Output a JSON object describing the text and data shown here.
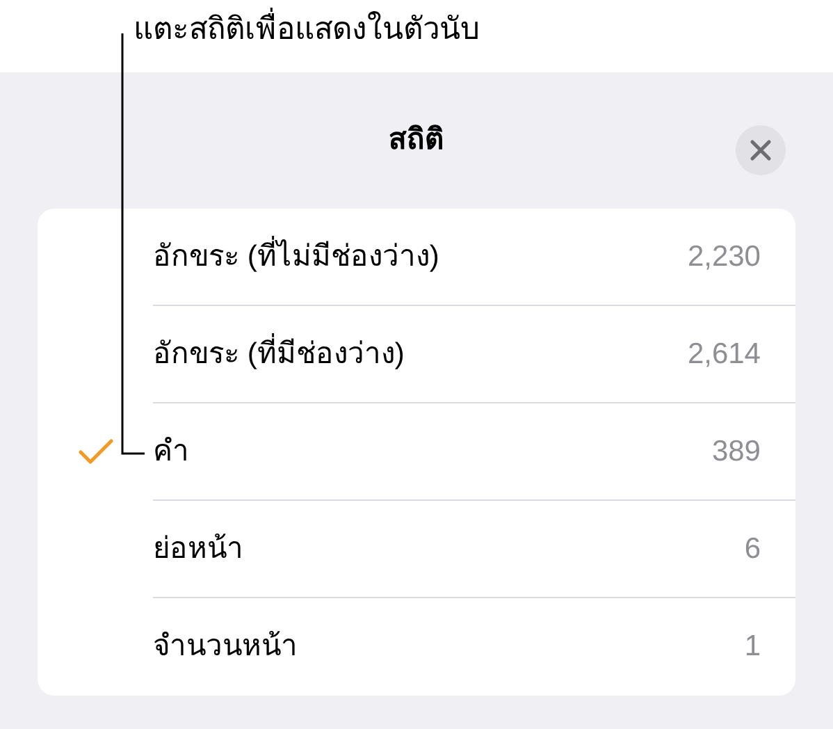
{
  "callout": "แตะสถิติเพื่อแสดงในตัวนับ",
  "title": "สถิติ",
  "rows": [
    {
      "label": "อักขระ (ที่ไม่มีช่องว่าง)",
      "value": "2,230",
      "checked": false
    },
    {
      "label": "อักขระ (ที่มีช่องว่าง)",
      "value": "2,614",
      "checked": false
    },
    {
      "label": "คำ",
      "value": "389",
      "checked": true
    },
    {
      "label": "ย่อหน้า",
      "value": "6",
      "checked": false
    },
    {
      "label": "จำนวนหน้า",
      "value": "1",
      "checked": false
    }
  ]
}
